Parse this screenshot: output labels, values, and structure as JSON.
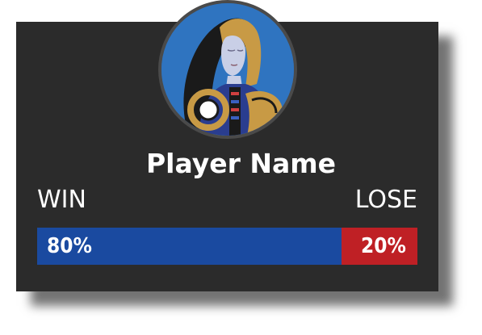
{
  "player": {
    "name": "Player Name",
    "avatar_icon": "queen-card-portrait-icon"
  },
  "stats": {
    "win_label": "WIN",
    "lose_label": "LOSE",
    "win_percent": 80,
    "lose_percent": 20,
    "win_text": "80%",
    "lose_text": "20%"
  },
  "colors": {
    "card_background": "#2b2b2b",
    "avatar_background": "#2f74c0",
    "win_bar": "#1a4aa0",
    "lose_bar": "#bf2025",
    "text": "#ffffff"
  }
}
